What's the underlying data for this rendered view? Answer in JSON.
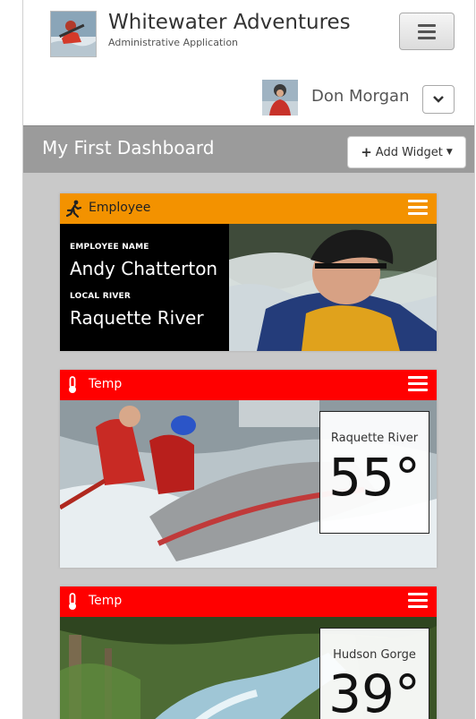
{
  "header": {
    "title": "Whitewater Adventures",
    "subtitle": "Administrative Application"
  },
  "user": {
    "name": "Don Morgan"
  },
  "dashboard": {
    "title": "My First Dashboard",
    "add_widget_label": "Add Widget"
  },
  "widgets": [
    {
      "type": "Employee",
      "header_color": "#f39200",
      "icon": "running-person-icon",
      "field1_label": "EMPLOYEE NAME",
      "field1_value": "Andy Chatterton",
      "field2_label": "LOCAL RIVER",
      "field2_value": "Raquette River"
    },
    {
      "type": "Temp",
      "header_color": "#ff0000",
      "icon": "thermometer-icon",
      "location": "Raquette River",
      "temperature": "55°"
    },
    {
      "type": "Temp",
      "header_color": "#ff0000",
      "icon": "thermometer-icon",
      "location": "Hudson Gorge",
      "temperature": "39°"
    }
  ]
}
